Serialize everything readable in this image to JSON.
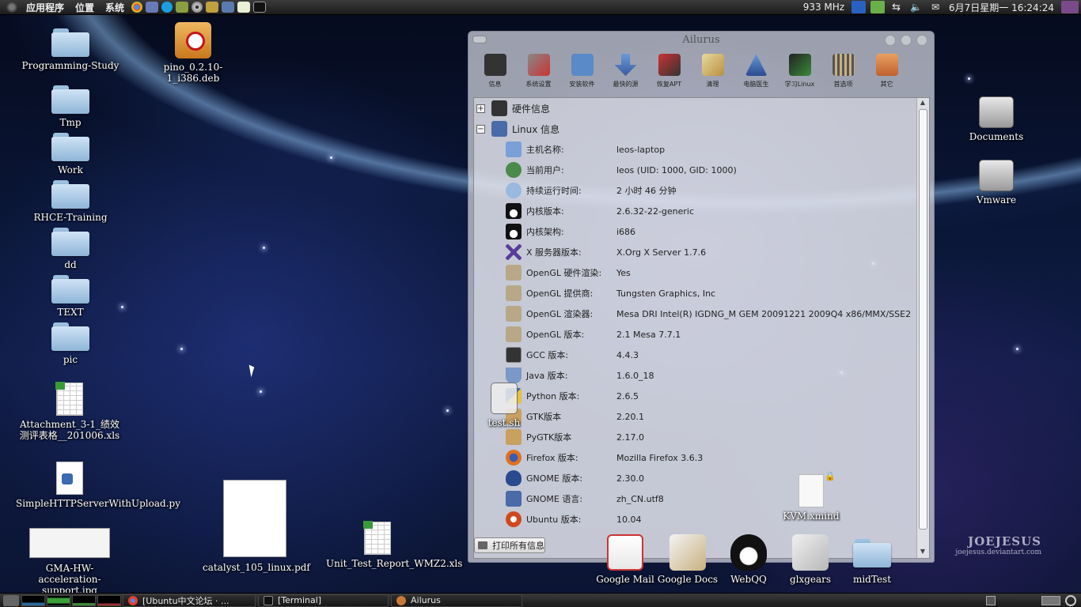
{
  "top_panel": {
    "menus": [
      "应用程序",
      "位置",
      "系统"
    ],
    "cpu_freq": "933 MHz",
    "datetime": "6月7日星期一  16:24:24"
  },
  "desktop_left": [
    {
      "label": "Programming-Study",
      "icon": "folder-icon"
    },
    {
      "label": "pino_0.2.10-1_i386.deb",
      "icon": "debian-package-icon"
    },
    {
      "label": "Tmp",
      "icon": "folder-icon"
    },
    {
      "label": "Work",
      "icon": "folder-icon"
    },
    {
      "label": "RHCE-Training",
      "icon": "folder-icon"
    },
    {
      "label": "dd",
      "icon": "folder-icon"
    },
    {
      "label": "TEXT",
      "icon": "folder-icon"
    },
    {
      "label": "pic",
      "icon": "folder-icon"
    },
    {
      "label": "Attachment_3-1_绩效测评表格__201006.xls",
      "icon": "spreadsheet-icon"
    },
    {
      "label": "SimpleHTTPServerWithUpload.py",
      "icon": "python-script-icon"
    },
    {
      "label": "GMA-HW-acceleration-support.jpg",
      "icon": "image-thumbnail-icon"
    },
    {
      "label": "catalyst_105_linux.pdf",
      "icon": "pdf-thumbnail-icon"
    },
    {
      "label": "Unit_Test_Report_WMZ2.xls",
      "icon": "spreadsheet-icon"
    }
  ],
  "desktop_right": [
    {
      "label": "Documents",
      "icon": "drive-icon"
    },
    {
      "label": "Vmware",
      "icon": "drive-icon"
    }
  ],
  "overlay_icons": [
    {
      "label": "test.sh",
      "icon": "script-icon"
    },
    {
      "label": "KVM.xmind",
      "icon": "xmind-file-icon"
    }
  ],
  "ailurus": {
    "title": "Ailurus",
    "toolbar": [
      "信息",
      "系统设置",
      "安装软件",
      "最快的源",
      "恢复APT",
      "清理",
      "电脑医生",
      "学习Linux",
      "首选项",
      "其它"
    ],
    "categories": [
      "硬件信息",
      "Linux 信息"
    ],
    "rows": [
      {
        "key": "主机名称:",
        "value": "leos-laptop"
      },
      {
        "key": "当前用户:",
        "value": "leos (UID: 1000, GID: 1000)"
      },
      {
        "key": "持续运行时间:",
        "value": "2 小时 46 分钟"
      },
      {
        "key": "内核版本:",
        "value": "2.6.32-22-generic"
      },
      {
        "key": "内核架构:",
        "value": "i686"
      },
      {
        "key": "X 服务器版本:",
        "value": "X.Org X Server 1.7.6"
      },
      {
        "key": "OpenGL 硬件渲染:",
        "value": "Yes"
      },
      {
        "key": "OpenGL 提供商:",
        "value": "Tungsten Graphics, Inc"
      },
      {
        "key": "OpenGL 渲染器:",
        "value": "Mesa DRI Intel(R) IGDNG_M GEM 20091221 2009Q4 x86/MMX/SSE2"
      },
      {
        "key": "OpenGL 版本:",
        "value": "2.1 Mesa 7.7.1"
      },
      {
        "key": "GCC 版本:",
        "value": "4.4.3"
      },
      {
        "key": "Java 版本:",
        "value": "1.6.0_18"
      },
      {
        "key": "Python 版本:",
        "value": "2.6.5"
      },
      {
        "key": "GTK版本",
        "value": "2.20.1"
      },
      {
        "key": "PyGTK版本",
        "value": "2.17.0"
      },
      {
        "key": "Firefox 版本:",
        "value": "Mozilla Firefox 3.6.3"
      },
      {
        "key": "GNOME 版本:",
        "value": "2.30.0"
      },
      {
        "key": "GNOME 语言:",
        "value": "zh_CN.utf8"
      },
      {
        "key": "Ubuntu 版本:",
        "value": "10.04"
      }
    ],
    "print_button": "打印所有信息"
  },
  "dock": [
    "Google Mail",
    "Google Docs",
    "WebQQ",
    "glxgears",
    "midTest"
  ],
  "watermark": {
    "line1": "JOEJESUS",
    "line2": "joejesus.deviantart.com"
  },
  "taskbar": {
    "tasks": [
      "[Ubuntu中文论坛 · ...",
      "[Terminal]",
      "Ailurus"
    ]
  },
  "colors": {
    "panel_bg": "#1c1c1c",
    "window_bg": "#d7dae4",
    "desktop_bg": "#0a1636"
  }
}
